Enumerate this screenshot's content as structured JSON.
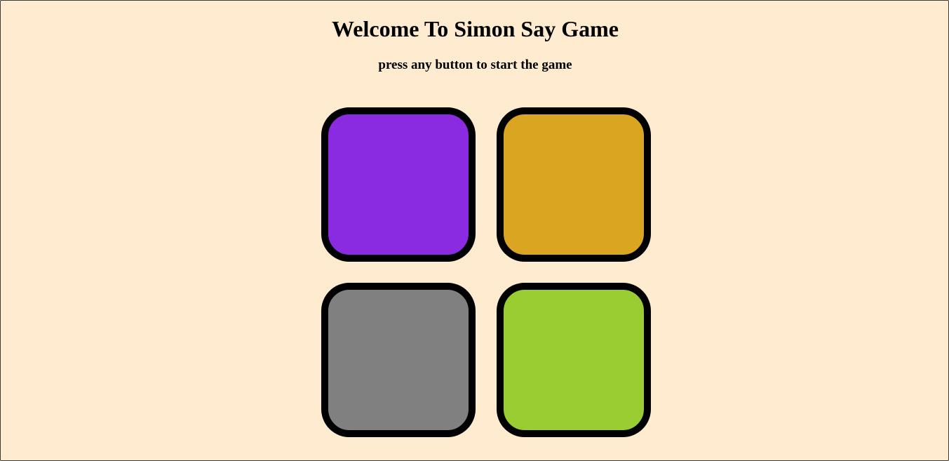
{
  "header": {
    "title": "Welcome To Simon Say Game",
    "subtitle": "press any button to start the game"
  },
  "colors": {
    "background": "#ffebd0",
    "border": "#000000"
  },
  "pads": [
    {
      "id": "purple",
      "color": "#8a2be2"
    },
    {
      "id": "yellow",
      "color": "#daa520"
    },
    {
      "id": "gray",
      "color": "#808080"
    },
    {
      "id": "green",
      "color": "#9acd32"
    }
  ]
}
